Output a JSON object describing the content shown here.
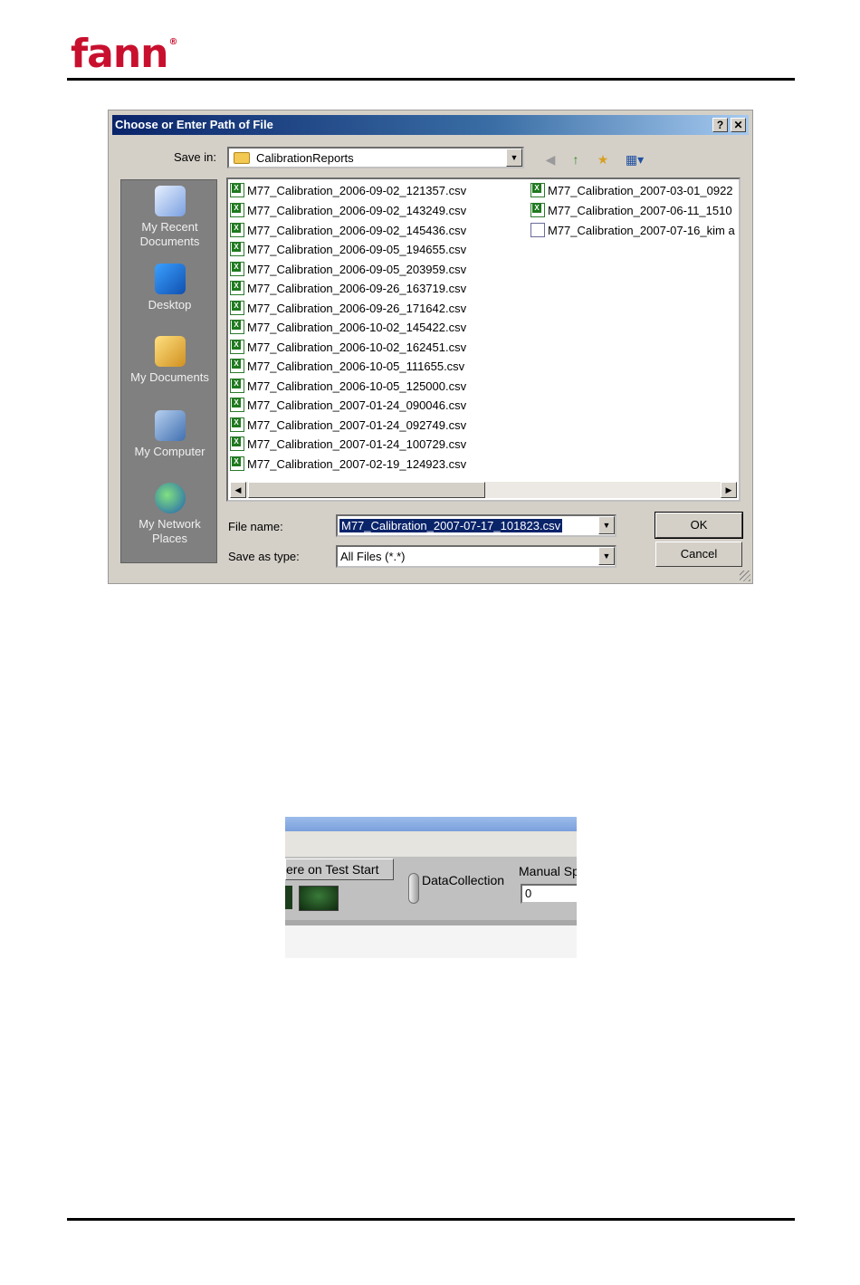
{
  "header": {
    "logo_text": "fann",
    "logo_mark": "®"
  },
  "dialog": {
    "title": "Choose or Enter Path of File",
    "help_btn": "?",
    "close_btn": "✕",
    "save_in_label": "Save in:",
    "save_in_value": "CalibrationReports",
    "places": [
      "My Recent Documents",
      "Desktop",
      "My Documents",
      "My Computer",
      "My Network Places"
    ],
    "files_col1": [
      "M77_Calibration_2006-09-02_121357.csv",
      "M77_Calibration_2006-09-02_143249.csv",
      "M77_Calibration_2006-09-02_145436.csv",
      "M77_Calibration_2006-09-05_194655.csv",
      "M77_Calibration_2006-09-05_203959.csv",
      "M77_Calibration_2006-09-26_163719.csv",
      "M77_Calibration_2006-09-26_171642.csv",
      "M77_Calibration_2006-10-02_145422.csv",
      "M77_Calibration_2006-10-02_162451.csv",
      "M77_Calibration_2006-10-05_111655.csv",
      "M77_Calibration_2006-10-05_125000.csv",
      "M77_Calibration_2007-01-24_090046.csv",
      "M77_Calibration_2007-01-24_092749.csv",
      "M77_Calibration_2007-01-24_100729.csv",
      "M77_Calibration_2007-02-19_124923.csv"
    ],
    "files_col2": [
      "M77_Calibration_2007-03-01_0922",
      "M77_Calibration_2007-06-11_1510",
      "M77_Calibration_2007-07-16_kim a"
    ],
    "file_name_label": "File name:",
    "file_name_value": "M77_Calibration_2007-07-17_101823.csv",
    "save_type_label": "Save as type:",
    "save_type_value": "All Files (*.*)",
    "ok_label": "OK",
    "cancel_label": "Cancel"
  },
  "panel": {
    "button_label": "ere on Test Start",
    "switch_label": "DataCollection",
    "manual_label": "Manual Sp",
    "manual_value": "0"
  }
}
